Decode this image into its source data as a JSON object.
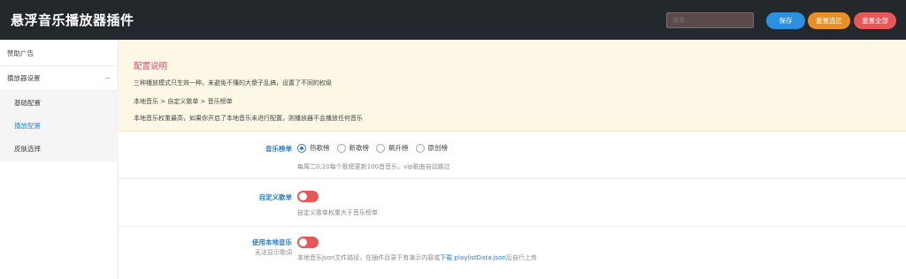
{
  "header": {
    "title": "悬浮音乐播放器插件",
    "search_placeholder": "搜索...",
    "save_label": "保存",
    "reset_selection_label": "重置选区",
    "reset_all_label": "重置全部"
  },
  "sidebar": {
    "items": [
      {
        "label": "赞助广告"
      },
      {
        "label": "播放器设置",
        "expander": "−"
      },
      {
        "label": "基础配置"
      },
      {
        "label": "播放配置",
        "active": true
      },
      {
        "label": "皮肤选择"
      }
    ]
  },
  "notice": {
    "title": "配置说明",
    "lines": [
      "三种播放模式只生效一种，未避免不懂的大傻子乱搞，设置了不同的权级",
      "本地音乐 > 自定义歌单 > 音乐榜单",
      "本地音乐权重最高，如果你开启了本地音乐未进行配置，则播放器不会播放任何音乐"
    ]
  },
  "settings": {
    "chart": {
      "label": "音乐榜单",
      "options": [
        "热歌榜",
        "新歌榜",
        "飙升榜",
        "原创榜"
      ],
      "selected": "热歌榜",
      "description": "每周二0:20每个歌榜更新100首音乐，vip歌曲自动跳过"
    },
    "custom_playlist": {
      "label": "自定义歌单",
      "enabled": false,
      "description": "自定义歌单权重大于音乐榜单"
    },
    "local_music": {
      "label": "使用本地音乐",
      "sublabel": "无法显示歌词",
      "enabled": false,
      "description_prefix": "本地音乐json文件路径，在插件目录下有演示内容或",
      "link_text": "下载 playlistData.json",
      "description_suffix": "后自行上传"
    }
  },
  "colors": {
    "header_bg": "#23282d",
    "save": "#2b90e0",
    "reset_selection": "#e88f25",
    "reset_all": "#e85656",
    "notice_title": "#d44d6e",
    "toggle_off": "#e85656"
  }
}
